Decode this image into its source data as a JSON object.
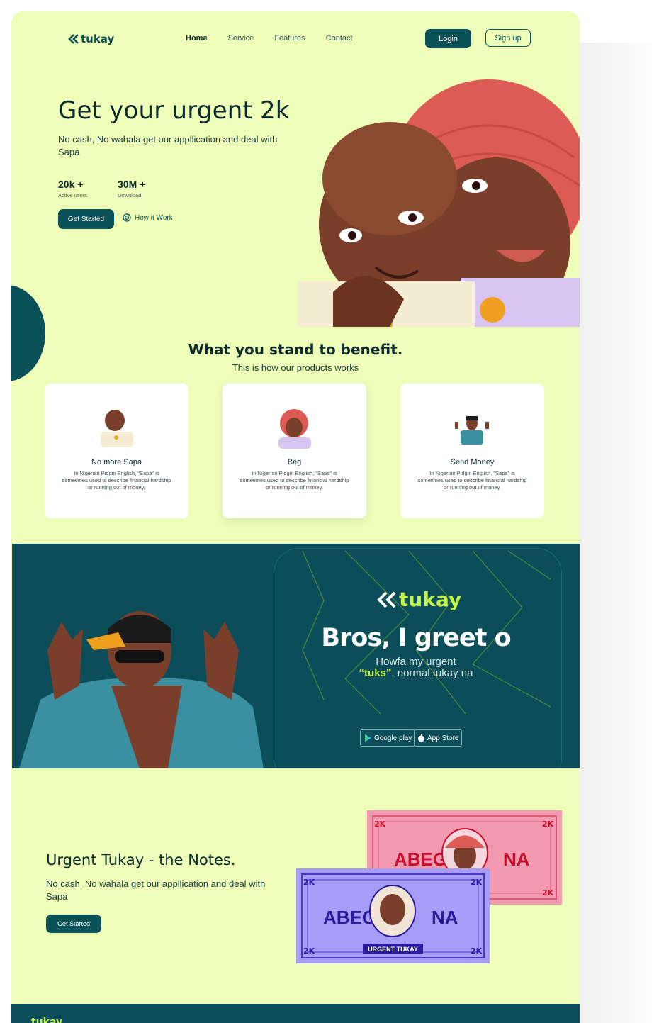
{
  "brand": {
    "name": "tukay"
  },
  "nav": {
    "items": [
      "Home",
      "Service",
      "Features",
      "Contact"
    ],
    "login": "Login",
    "signup": "Sign up"
  },
  "hero": {
    "title": "Get your urgent 2k",
    "subtitle": "No cash, No wahala get our appllication  and deal with Sapa",
    "stats": [
      {
        "value": "20k +",
        "label": "Active users"
      },
      {
        "value": "30M +",
        "label": "Download"
      }
    ],
    "cta": "Get Started",
    "how": "How it Work"
  },
  "benefits": {
    "title": "What you stand to benefit.",
    "subtitle": "This is how our products works",
    "cards": [
      {
        "title": "No more Sapa",
        "desc": "In Nigerian Pidgin English, \"Sapa\" is sometimes used to describe financial hardship or running out of money."
      },
      {
        "title": "Beg",
        "desc": "In Nigerian Pidgin English, \"Sapa\" is sometimes used to describe financial hardship or running out of money."
      },
      {
        "title": "Send Money",
        "desc": "In Nigerian Pidgin English, \"Sapa\" is sometimes used to describe financial hardship or running out of money."
      }
    ]
  },
  "banner": {
    "logo": "tukay",
    "title": "Bros, I greet o",
    "line1": "Howfa my urgent",
    "line2_highlight": "“tuks”",
    "line2_rest": ", normal tukay na",
    "google": "Google play",
    "apple": "App Store"
  },
  "notes": {
    "title": "Urgent Tukay - the Notes.",
    "subtitle": "No cash, No wahala get our appllication  and deal with Sapa",
    "cta": "Get Started",
    "note_pink": {
      "corner": "2K",
      "left": "ABEG",
      "right": "NA"
    },
    "note_purple": {
      "corner": "2K",
      "left": "ABEG",
      "right": "NA",
      "ribbon": "URGENT TUKAY"
    }
  },
  "footer": {
    "logo": "tukay"
  },
  "colors": {
    "bg": "#eefdb8",
    "primary": "#0b5158",
    "accent": "#c4f24a",
    "banner": "#0b4d58"
  }
}
